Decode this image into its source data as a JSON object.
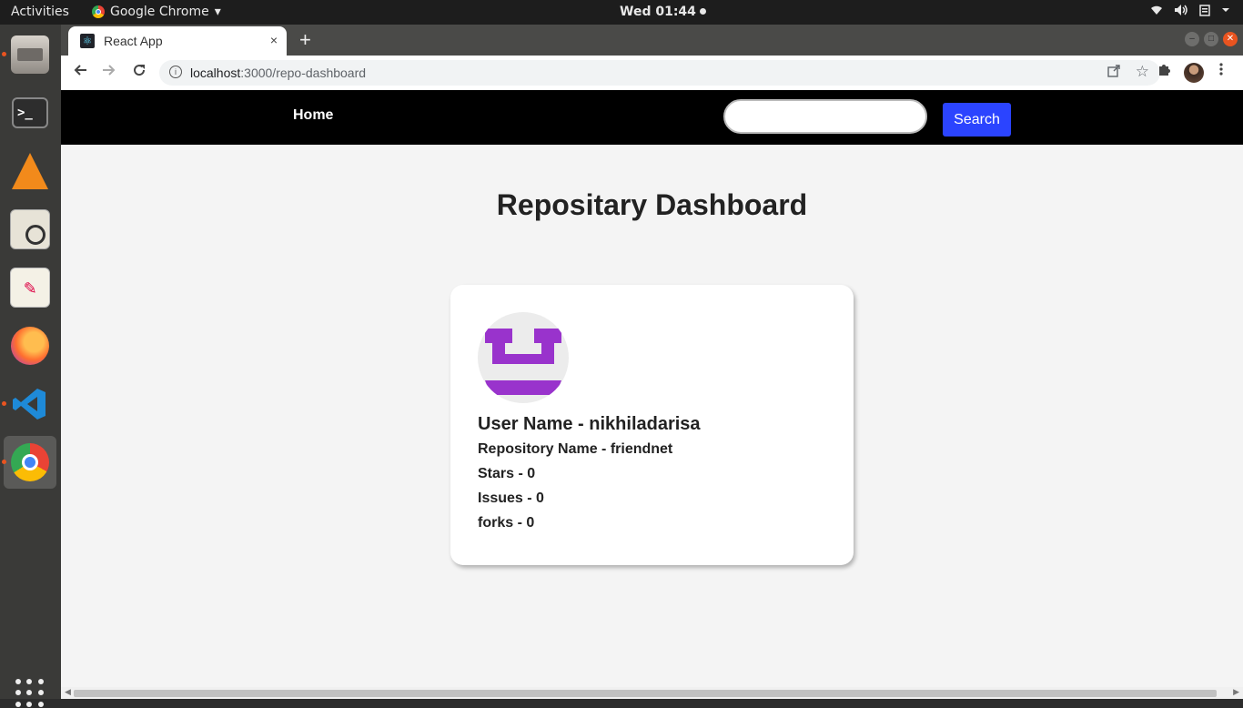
{
  "system": {
    "activities_label": "Activities",
    "app_name": "Google Chrome",
    "app_menu_arrow": "▾",
    "clock": "Wed 01:44",
    "tray_icons": [
      "wifi-icon",
      "volume-icon",
      "clipboard-icon",
      "power-menu-icon"
    ]
  },
  "dock": {
    "items": [
      "files",
      "terminal",
      "vlc",
      "image-viewer",
      "text-editor",
      "firefox",
      "vscode",
      "chrome"
    ],
    "terminal_glyph": ">_"
  },
  "browser": {
    "tab_title": "React App",
    "tab_close": "×",
    "new_tab": "+",
    "url_host": "localhost",
    "url_rest": ":3000/repo-dashboard"
  },
  "app": {
    "nav_home": "Home",
    "search_value": "",
    "search_button": "Search",
    "page_title": "Repositary Dashboard",
    "card": {
      "user_name": "User Name - nikhiladarisa",
      "repo_name": "Repository Name - friendnet",
      "stars": "Stars - 0",
      "issues": "Issues - 0",
      "forks": "forks - 0"
    }
  },
  "colors": {
    "navbar_bg": "#000000",
    "search_button_bg": "#2b44ff",
    "avatar_logo_purple": "#9933cc",
    "page_bg": "#f4f4f4",
    "ubuntu_accent": "#e95420"
  }
}
